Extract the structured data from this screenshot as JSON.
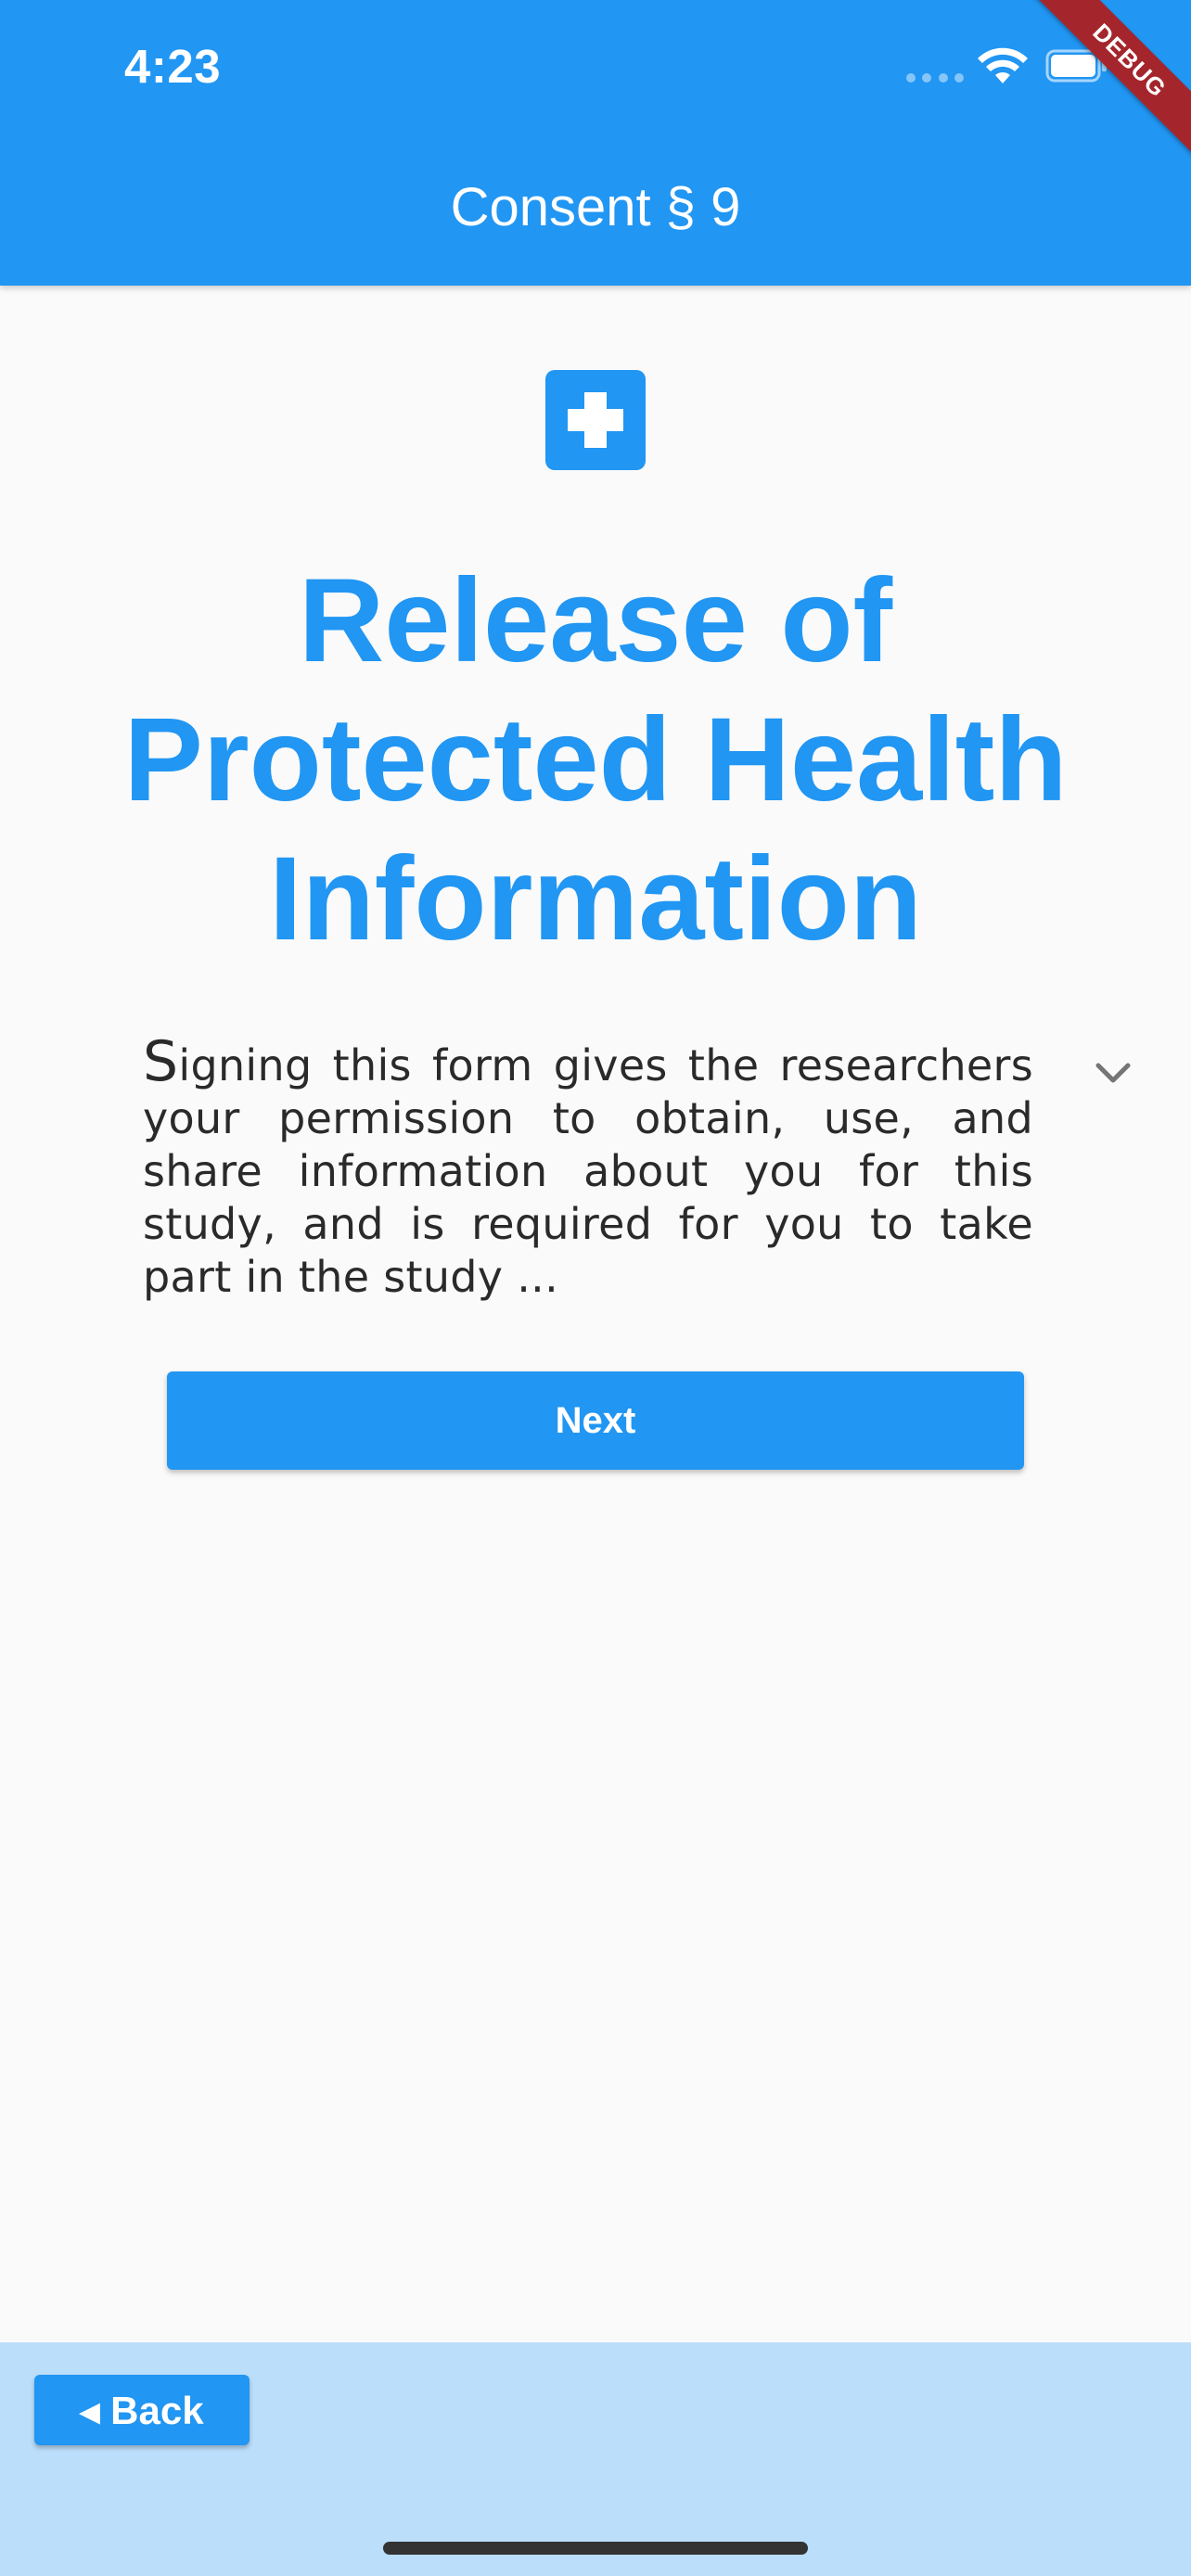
{
  "status_bar": {
    "time": "4:23"
  },
  "app_bar": {
    "title": "Consent § 9",
    "debug_label": "DEBUG"
  },
  "section": {
    "icon": "medical-cross-icon",
    "title": "Release of Protected Health Information",
    "summary_first_letter": "S",
    "summary_rest": "igning this form gives the researchers your permission to obtain, use, and share information about you for this study, and is required for you to take part in the study ..."
  },
  "actions": {
    "next_label": "Next",
    "back_label": "◂ Back"
  },
  "colors": {
    "primary": "#2196f3",
    "bottom_bar": "#bbdefb",
    "background": "#fafafa",
    "debug_ribbon": "#a4262c"
  }
}
